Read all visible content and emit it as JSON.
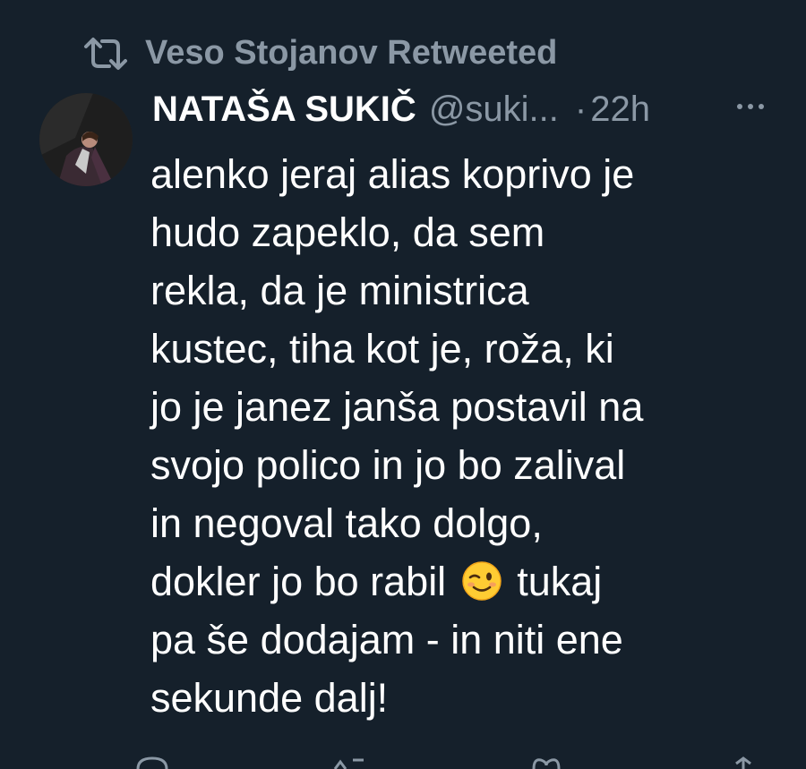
{
  "retweet": {
    "text": "Veso Stojanov Retweeted",
    "icon": "retweet-icon"
  },
  "author": {
    "name": "NATAŠA SUKIČ",
    "handle": "@suki...",
    "separator": "·",
    "time": "22h",
    "avatar_icon": "avatar"
  },
  "tweet": {
    "lines": [
      "alenko jeraj alias koprivo je",
      "hudo zapeklo, da sem",
      "rekla, da je ministrica",
      "kustec, tiha kot je, roža, ki",
      "jo je janez janša postavil na",
      "svojo polico in jo bo zalival",
      "in negoval tako dolgo,",
      "dokler jo bo rabil",
      "tukaj",
      "pa še dodajam - in niti ene",
      "sekunde dalj!"
    ],
    "emoji": "winking-face-emoji"
  },
  "actions": [
    "reply-icon",
    "retweet-icon",
    "like-icon",
    "share-icon"
  ],
  "colors": {
    "background": "#15202b",
    "text": "#ffffff",
    "secondary": "#8b98a5"
  }
}
